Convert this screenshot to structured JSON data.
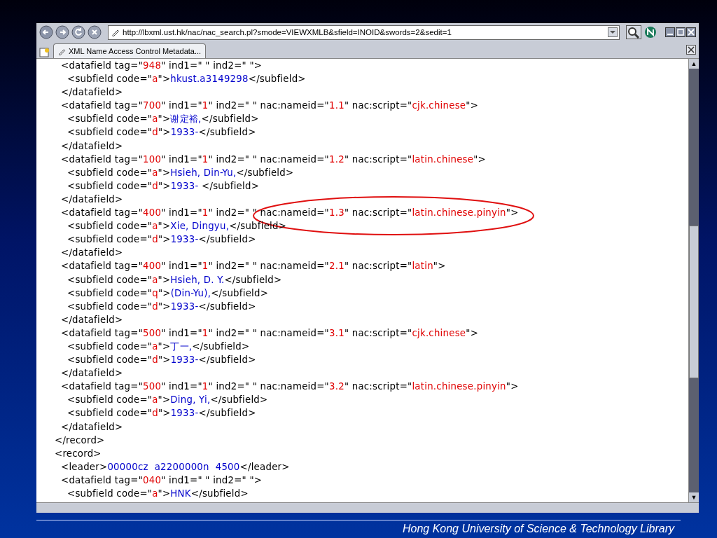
{
  "browser": {
    "url": "http://lbxml.ust.hk/nac/nac_search.pl?smode=VIEWXMLB&sfield=INOID&swords=2&sedit=1",
    "tab": {
      "title": "XML Name Access Control Metadata...",
      "selected": true
    },
    "scroll_up": "▲",
    "scroll_down": "▼"
  },
  "records": [
    {
      "lines": [
        {
          "parts": [
            {
              "kind": "markup",
              "text": "<datafield tag=\""
            },
            {
              "kind": "value",
              "text": "948"
            },
            {
              "kind": "markup",
              "text": "\" ind1=\" \" ind2=\" \">"
            }
          ],
          "children": [
            {
              "parts": [
                {
                  "kind": "markup",
                  "text": "<subfield code=\""
                },
                {
                  "kind": "value",
                  "text": "a"
                },
                {
                  "kind": "markup",
                  "text": "\">"
                },
                {
                  "kind": "content",
                  "text": "hkust.a3149298"
                },
                {
                  "kind": "markup",
                  "text": "</subfield>"
                }
              ]
            }
          ]
        },
        {
          "parts": [
            {
              "kind": "markup",
              "text": "</datafield>"
            }
          ]
        },
        {
          "parts": [
            {
              "kind": "markup",
              "text": "<datafield tag=\""
            },
            {
              "kind": "value",
              "text": "700"
            },
            {
              "kind": "markup",
              "text": "\" ind1=\""
            },
            {
              "kind": "value",
              "text": "1"
            },
            {
              "kind": "markup",
              "text": "\" ind2=\" \" nac:nameid=\""
            },
            {
              "kind": "value",
              "text": "1.1"
            },
            {
              "kind": "markup",
              "text": "\" nac:script=\""
            },
            {
              "kind": "value",
              "text": "cjk.chinese"
            },
            {
              "kind": "markup",
              "text": "\">"
            }
          ],
          "children": [
            {
              "parts": [
                {
                  "kind": "markup",
                  "text": "<subfield code=\""
                },
                {
                  "kind": "value",
                  "text": "a"
                },
                {
                  "kind": "markup",
                  "text": "\">"
                },
                {
                  "kind": "content",
                  "text": "谢定裕,"
                },
                {
                  "kind": "markup",
                  "text": "</subfield>"
                }
              ]
            },
            {
              "parts": [
                {
                  "kind": "markup",
                  "text": "<subfield code=\""
                },
                {
                  "kind": "value",
                  "text": "d"
                },
                {
                  "kind": "markup",
                  "text": "\">"
                },
                {
                  "kind": "content",
                  "text": "1933-"
                },
                {
                  "kind": "markup",
                  "text": "</subfield>"
                }
              ]
            }
          ]
        },
        {
          "parts": [
            {
              "kind": "markup",
              "text": "</datafield>"
            }
          ]
        },
        {
          "parts": [
            {
              "kind": "markup",
              "text": "<datafield tag=\""
            },
            {
              "kind": "value",
              "text": "100"
            },
            {
              "kind": "markup",
              "text": "\" ind1=\""
            },
            {
              "kind": "value",
              "text": "1"
            },
            {
              "kind": "markup",
              "text": "\" ind2=\" \" nac:nameid=\""
            },
            {
              "kind": "value",
              "text": "1.2"
            },
            {
              "kind": "markup",
              "text": "\" nac:script=\""
            },
            {
              "kind": "value",
              "text": "latin.chinese"
            },
            {
              "kind": "markup",
              "text": "\">"
            }
          ],
          "children": [
            {
              "parts": [
                {
                  "kind": "markup",
                  "text": "<subfield code=\""
                },
                {
                  "kind": "value",
                  "text": "a"
                },
                {
                  "kind": "markup",
                  "text": "\">"
                },
                {
                  "kind": "content",
                  "text": "Hsieh, Din-Yu,"
                },
                {
                  "kind": "markup",
                  "text": "</subfield>"
                }
              ]
            },
            {
              "parts": [
                {
                  "kind": "markup",
                  "text": "<subfield code=\""
                },
                {
                  "kind": "value",
                  "text": "d"
                },
                {
                  "kind": "markup",
                  "text": "\">"
                },
                {
                  "kind": "content",
                  "text": "1933- "
                },
                {
                  "kind": "markup",
                  "text": "</subfield>"
                }
              ]
            }
          ]
        },
        {
          "parts": [
            {
              "kind": "markup",
              "text": "</datafield>"
            }
          ]
        },
        {
          "parts": [
            {
              "kind": "markup",
              "text": "<datafield tag=\""
            },
            {
              "kind": "value",
              "text": "400"
            },
            {
              "kind": "markup",
              "text": "\" ind1=\""
            },
            {
              "kind": "value",
              "text": "1"
            },
            {
              "kind": "markup",
              "text": "\" ind2=\" \" nac:nameid=\""
            },
            {
              "kind": "value",
              "text": "1.3"
            },
            {
              "kind": "markup",
              "text": "\" nac:script=\""
            },
            {
              "kind": "value",
              "text": "latin.chinese.pinyin"
            },
            {
              "kind": "markup",
              "text": "\">"
            }
          ],
          "children": [
            {
              "parts": [
                {
                  "kind": "markup",
                  "text": "<subfield code=\""
                },
                {
                  "kind": "value",
                  "text": "a"
                },
                {
                  "kind": "markup",
                  "text": "\">"
                },
                {
                  "kind": "content",
                  "text": "Xie, Dingyu,"
                },
                {
                  "kind": "markup",
                  "text": "</subfield>"
                }
              ]
            },
            {
              "parts": [
                {
                  "kind": "markup",
                  "text": "<subfield code=\""
                },
                {
                  "kind": "value",
                  "text": "d"
                },
                {
                  "kind": "markup",
                  "text": "\">"
                },
                {
                  "kind": "content",
                  "text": "1933-"
                },
                {
                  "kind": "markup",
                  "text": "</subfield>"
                }
              ]
            }
          ]
        },
        {
          "parts": [
            {
              "kind": "markup",
              "text": "</datafield>"
            }
          ]
        },
        {
          "parts": [
            {
              "kind": "markup",
              "text": "<datafield tag=\""
            },
            {
              "kind": "value",
              "text": "400"
            },
            {
              "kind": "markup",
              "text": "\" ind1=\""
            },
            {
              "kind": "value",
              "text": "1"
            },
            {
              "kind": "markup",
              "text": "\" ind2=\" \" nac:nameid=\""
            },
            {
              "kind": "value",
              "text": "2.1"
            },
            {
              "kind": "markup",
              "text": "\" nac:script=\""
            },
            {
              "kind": "value",
              "text": "latin"
            },
            {
              "kind": "markup",
              "text": "\">"
            }
          ],
          "children": [
            {
              "parts": [
                {
                  "kind": "markup",
                  "text": "<subfield code=\""
                },
                {
                  "kind": "value",
                  "text": "a"
                },
                {
                  "kind": "markup",
                  "text": "\">"
                },
                {
                  "kind": "content",
                  "text": "Hsieh, D. Y."
                },
                {
                  "kind": "markup",
                  "text": "</subfield>"
                }
              ]
            },
            {
              "parts": [
                {
                  "kind": "markup",
                  "text": "<subfield code=\""
                },
                {
                  "kind": "value",
                  "text": "q"
                },
                {
                  "kind": "markup",
                  "text": "\">"
                },
                {
                  "kind": "content",
                  "text": "(Din-Yu),"
                },
                {
                  "kind": "markup",
                  "text": "</subfield>"
                }
              ]
            },
            {
              "parts": [
                {
                  "kind": "markup",
                  "text": "<subfield code=\""
                },
                {
                  "kind": "value",
                  "text": "d"
                },
                {
                  "kind": "markup",
                  "text": "\">"
                },
                {
                  "kind": "content",
                  "text": "1933-"
                },
                {
                  "kind": "markup",
                  "text": "</subfield>"
                }
              ]
            }
          ]
        },
        {
          "parts": [
            {
              "kind": "markup",
              "text": "</datafield>"
            }
          ]
        },
        {
          "parts": [
            {
              "kind": "markup",
              "text": "<datafield tag=\""
            },
            {
              "kind": "value",
              "text": "500"
            },
            {
              "kind": "markup",
              "text": "\" ind1=\""
            },
            {
              "kind": "value",
              "text": "1"
            },
            {
              "kind": "markup",
              "text": "\" ind2=\" \" nac:nameid=\""
            },
            {
              "kind": "value",
              "text": "3.1"
            },
            {
              "kind": "markup",
              "text": "\" nac:script=\""
            },
            {
              "kind": "value",
              "text": "cjk.chinese"
            },
            {
              "kind": "markup",
              "text": "\">"
            }
          ],
          "children": [
            {
              "parts": [
                {
                  "kind": "markup",
                  "text": "<subfield code=\""
                },
                {
                  "kind": "value",
                  "text": "a"
                },
                {
                  "kind": "markup",
                  "text": "\">"
                },
                {
                  "kind": "content",
                  "text": "丁一,"
                },
                {
                  "kind": "markup",
                  "text": "</subfield>"
                }
              ]
            },
            {
              "parts": [
                {
                  "kind": "markup",
                  "text": "<subfield code=\""
                },
                {
                  "kind": "value",
                  "text": "d"
                },
                {
                  "kind": "markup",
                  "text": "\">"
                },
                {
                  "kind": "content",
                  "text": "1933-"
                },
                {
                  "kind": "markup",
                  "text": "</subfield>"
                }
              ]
            }
          ]
        },
        {
          "parts": [
            {
              "kind": "markup",
              "text": "</datafield>"
            }
          ]
        },
        {
          "parts": [
            {
              "kind": "markup",
              "text": "<datafield tag=\""
            },
            {
              "kind": "value",
              "text": "500"
            },
            {
              "kind": "markup",
              "text": "\" ind1=\""
            },
            {
              "kind": "value",
              "text": "1"
            },
            {
              "kind": "markup",
              "text": "\" ind2=\" \" nac:nameid=\""
            },
            {
              "kind": "value",
              "text": "3.2"
            },
            {
              "kind": "markup",
              "text": "\" nac:script=\""
            },
            {
              "kind": "value",
              "text": "latin.chinese.pinyin"
            },
            {
              "kind": "markup",
              "text": "\">"
            }
          ],
          "children": [
            {
              "parts": [
                {
                  "kind": "markup",
                  "text": "<subfield code=\""
                },
                {
                  "kind": "value",
                  "text": "a"
                },
                {
                  "kind": "markup",
                  "text": "\">"
                },
                {
                  "kind": "content",
                  "text": "Ding, Yi,"
                },
                {
                  "kind": "markup",
                  "text": "</subfield>"
                }
              ]
            },
            {
              "parts": [
                {
                  "kind": "markup",
                  "text": "<subfield code=\""
                },
                {
                  "kind": "value",
                  "text": "d"
                },
                {
                  "kind": "markup",
                  "text": "\">"
                },
                {
                  "kind": "content",
                  "text": "1933-"
                },
                {
                  "kind": "markup",
                  "text": "</subfield>"
                }
              ]
            }
          ]
        },
        {
          "parts": [
            {
              "kind": "markup",
              "text": "</datafield>"
            }
          ]
        }
      ],
      "close": [
        {
          "kind": "markup",
          "text": "</record>"
        }
      ]
    },
    {
      "open": [
        {
          "kind": "markup",
          "text": "<record>"
        }
      ],
      "lines": [
        {
          "parts": [
            {
              "kind": "markup",
              "text": "<leader>"
            },
            {
              "kind": "content",
              "text": "00000cz  a2200000n  4500"
            },
            {
              "kind": "markup",
              "text": "</leader>"
            }
          ]
        },
        {
          "parts": [
            {
              "kind": "markup",
              "text": "<datafield tag=\""
            },
            {
              "kind": "value",
              "text": "040"
            },
            {
              "kind": "markup",
              "text": "\" ind1=\" \" ind2=\" \">"
            }
          ],
          "children": [
            {
              "parts": [
                {
                  "kind": "markup",
                  "text": "<subfield code=\""
                },
                {
                  "kind": "value",
                  "text": "a"
                },
                {
                  "kind": "markup",
                  "text": "\">"
                },
                {
                  "kind": "content",
                  "text": "HNK"
                },
                {
                  "kind": "markup",
                  "text": "</subfield>"
                }
              ]
            }
          ]
        }
      ]
    }
  ],
  "footer": "Hong Kong University of Science & Technology Library"
}
